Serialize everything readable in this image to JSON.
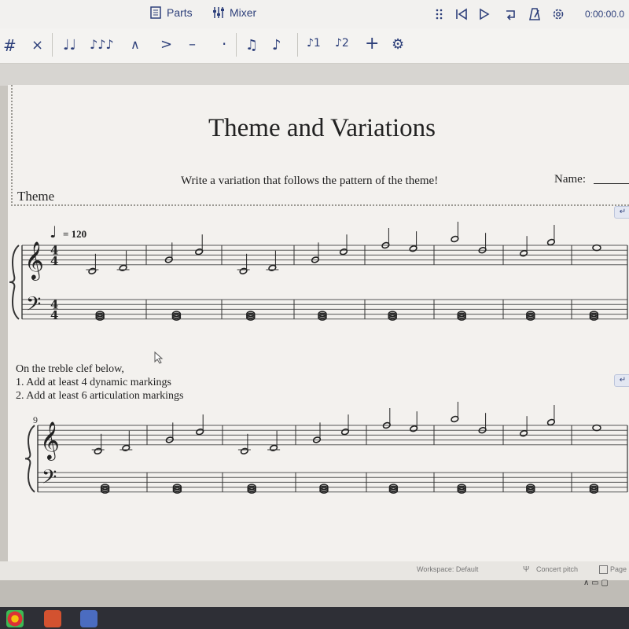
{
  "topbar": {
    "parts_label": "Parts",
    "mixer_label": "Mixer",
    "time": "0:00:00.0",
    "icons": [
      "grip-icon",
      "rewind-icon",
      "play-icon",
      "loop-icon",
      "metronome-icon",
      "settings-icon"
    ]
  },
  "toolbar": {
    "items": [
      {
        "name": "sharp-button",
        "glyph": "#"
      },
      {
        "name": "toggle-natural-button",
        "glyph": "×"
      },
      {
        "name": "tie-button",
        "glyph": "♩♩"
      },
      {
        "name": "slur-button",
        "glyph": "♪♪♪"
      },
      {
        "name": "marcato-button",
        "glyph": "∧"
      },
      {
        "name": "accent-button",
        "glyph": ">"
      },
      {
        "name": "tenuto-button",
        "glyph": "–"
      },
      {
        "name": "staccato-button",
        "glyph": "·"
      },
      {
        "name": "tuplet-button",
        "glyph": "♫"
      },
      {
        "name": "flip-direction-button",
        "glyph": "♪"
      },
      {
        "name": "voice-1-button",
        "glyph": "♪1"
      },
      {
        "name": "voice-2-button",
        "glyph": "♪2"
      },
      {
        "name": "add-button",
        "glyph": "+"
      },
      {
        "name": "customize-toolbar-button",
        "glyph": "⚙"
      }
    ]
  },
  "score": {
    "title": "Theme and Variations",
    "subtitle": "Write a variation that follows the pattern of the theme!",
    "name_label": "Name:",
    "theme_label": "Theme",
    "tempo": "= 120",
    "time_signature_top": "4",
    "time_signature_bottom": "4",
    "measure_number": "9",
    "instructions": [
      "On the treble clef below,",
      "1. Add at least 4 dynamic markings",
      "2. Add at least 6 articulation markings"
    ]
  },
  "status": {
    "workspace": "Workspace: Default",
    "concert_pitch": "Concert pitch",
    "page": "Page"
  }
}
